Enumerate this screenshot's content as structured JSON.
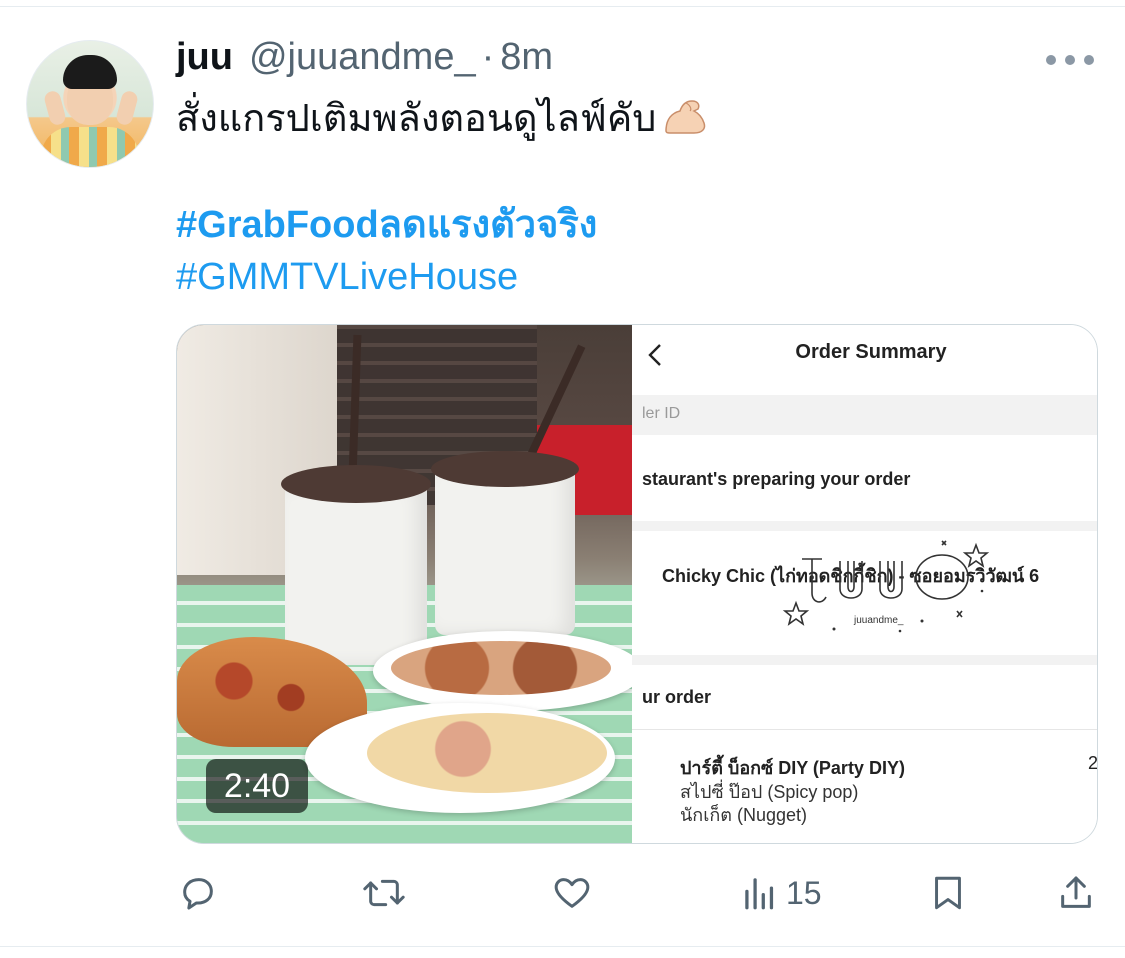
{
  "tweet": {
    "name": "juu",
    "handle": "@juuandme_",
    "separator": "·",
    "time": "8m",
    "text_line1": "สั่งแกรปเติมพลังตอนดูไลฟ์คับ",
    "emoji": "flexed-biceps",
    "hashtag1": "#GrabFoodลดแรงตัวจริง",
    "hashtag2": "#GMMTVLiveHouse"
  },
  "media": {
    "video_duration": "2:40",
    "screenshot": {
      "title": "Order Summary",
      "order_id_label": "ler ID",
      "status": "staurant's preparing your order",
      "restaurant": "Chicky Chic (ไก่ทอดชิกกี้ชิก) - ซอยอมรวิวัฒน์ 6",
      "signature_text": "juuandme_",
      "your_order_label": "ur order",
      "items": [
        "ปาร์ตี้ บ็อกซ์ DIY (Party DIY)",
        "สไปซี่ ป๊อป (Spicy pop)",
        "นักเก็ต (Nugget)"
      ],
      "quantity": "2"
    }
  },
  "actions": {
    "reply_icon": "reply-icon",
    "retweet_icon": "retweet-icon",
    "like_icon": "heart-icon",
    "views_icon": "analytics-icon",
    "views_count": "15",
    "bookmark_icon": "bookmark-icon",
    "share_icon": "share-icon"
  },
  "colors": {
    "accent": "#1d9bf0",
    "secondary_text": "#536471"
  }
}
